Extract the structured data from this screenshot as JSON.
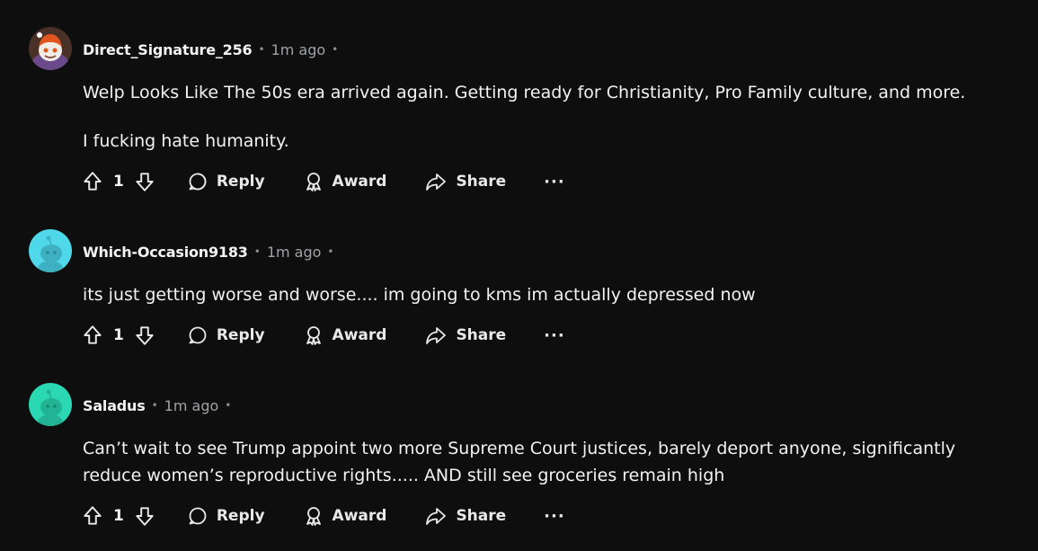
{
  "comments": [
    {
      "author": "Direct_Signature_256",
      "time": "1m ago",
      "paragraphs": [
        "Welp Looks Like The 50s era arrived again. Getting ready for Christianity, Pro Family culture, and more.",
        "I fucking hate humanity."
      ],
      "votes": "1"
    },
    {
      "author": "Which-Occasion9183",
      "time": "1m ago",
      "paragraphs": [
        "its just getting worse and worse.... im going to kms im actually depressed now"
      ],
      "votes": "1"
    },
    {
      "author": "Saladus",
      "time": "1m ago",
      "paragraphs": [
        "Can’t wait to see Trump appoint two more Supreme Court justices, barely deport anyone, significantly reduce women’s reproductive rights..... AND still see groceries remain high"
      ],
      "votes": "1"
    }
  ],
  "actions": {
    "reply": "Reply",
    "award": "Award",
    "share": "Share",
    "more": "···"
  },
  "separator": "•",
  "colors": {
    "background": "#0e0e0f",
    "avatar_cyan": "#4fd8ea",
    "avatar_teal": "#2ad9b4",
    "avatar_orange": "#e2551e"
  },
  "icons": [
    "upvote-icon",
    "downvote-icon",
    "comment-icon",
    "award-icon",
    "share-icon",
    "more-icon"
  ]
}
